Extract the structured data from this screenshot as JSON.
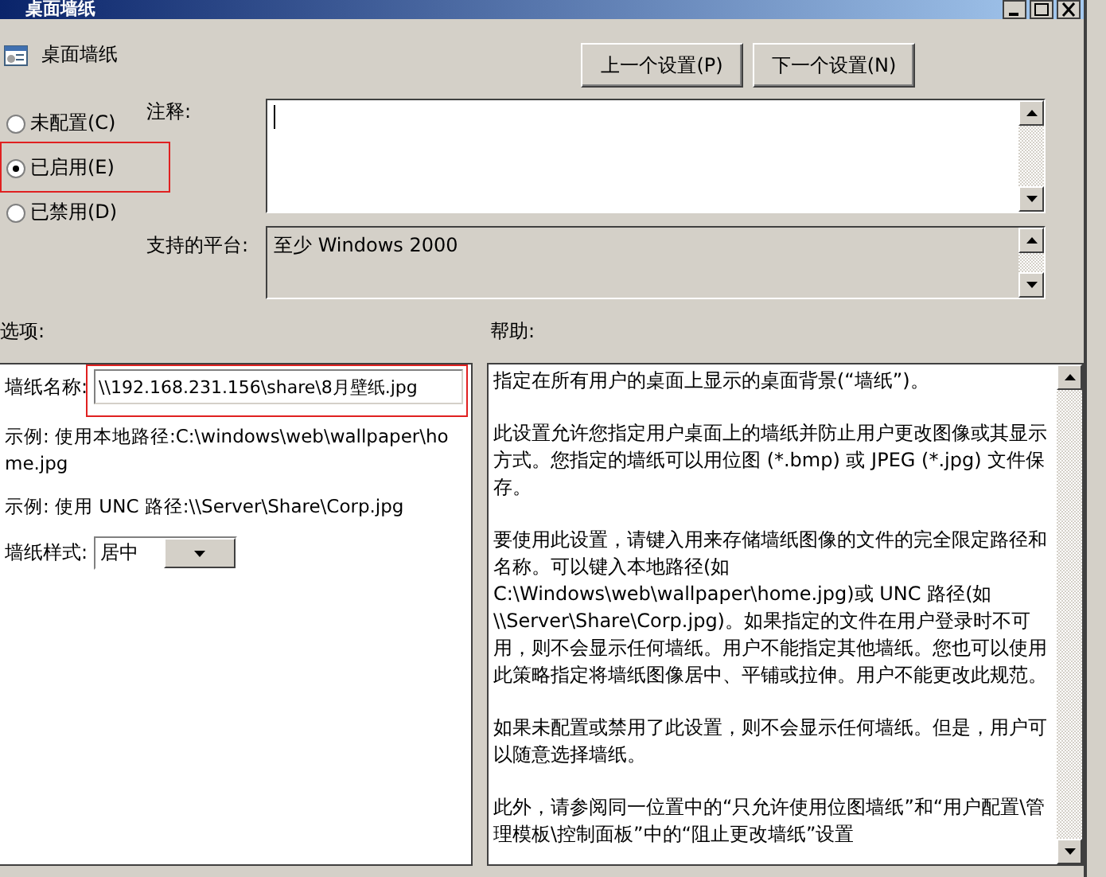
{
  "window": {
    "title": "桌面墙纸"
  },
  "header": {
    "title": "桌面墙纸"
  },
  "nav_buttons": [
    "上一个设置(P)",
    "下一个设置(N)"
  ],
  "state_options": [
    {
      "label": "未配置(C)",
      "selected": false,
      "highlighted": false
    },
    {
      "label": "已启用(E)",
      "selected": true,
      "highlighted": true
    },
    {
      "label": "已禁用(D)",
      "selected": false,
      "highlighted": false
    }
  ],
  "comment": {
    "label": "注释:",
    "focused": true
  },
  "platform": {
    "label": "支持的平台:",
    "value": "至少 Windows 2000"
  },
  "options": {
    "label": "选项:",
    "wallpaper_name": {
      "label": "墙纸名称:",
      "value": "\\\\192.168.231.156\\share\\8月壁纸.jpg",
      "highlighted": true
    },
    "examples": [
      "示例: 使用本地路径:C:\\windows\\web\\wallpaper\\home.jpg",
      "示例: 使用 UNC 路径:\\\\Server\\Share\\Corp.jpg"
    ],
    "wallpaper_style": {
      "label": "墙纸样式:",
      "value": "居中"
    }
  },
  "help": {
    "label": "帮助:",
    "paragraphs": [
      "指定在所有用户的桌面上显示的桌面背景(“墙纸”)。",
      "此设置允许您指定用户桌面上的墙纸并防止用户更改图像或其显示方式。您指定的墙纸可以用位图 (*.bmp) 或 JPEG (*.jpg) 文件保存。",
      "要使用此设置，请键入用来存储墙纸图像的文件的完全限定路径和名称。可以键入本地路径(如 C:\\Windows\\web\\wallpaper\\home.jpg)或 UNC 路径(如 \\\\Server\\Share\\Corp.jpg)。如果指定的文件在用户登录时不可用，则不会显示任何墙纸。用户不能指定其他墙纸。您也可以使用此策略指定将墙纸图像居中、平铺或拉伸。用户不能更改此规范。",
      "如果未配置或禁用了此设置，则不会显示任何墙纸。但是，用户可以随意选择墙纸。",
      "此外，请参阅同一位置中的“只允许使用位图墙纸”和“用户配置\\管理模板\\控制面板”中的“阻止更改墙纸”设置"
    ]
  }
}
